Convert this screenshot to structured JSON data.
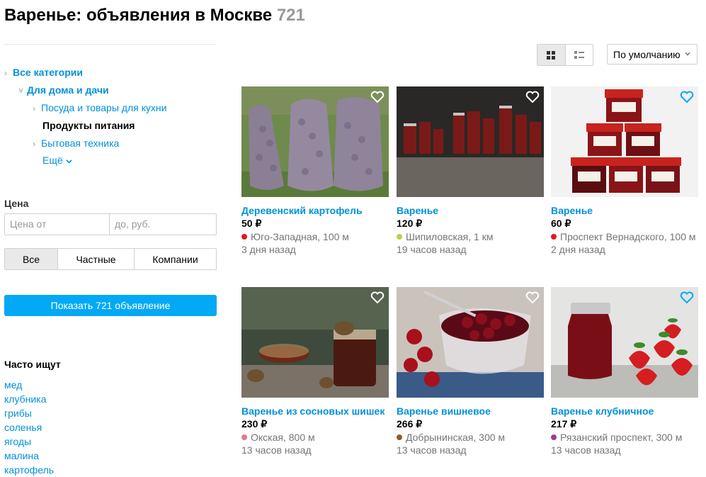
{
  "header": {
    "title": "Варенье: объявления в Москве",
    "count": "721"
  },
  "categories": {
    "all": "Все категории",
    "home": "Для дома и дачи",
    "dishes": "Посуда и товары для кухни",
    "food": "Продукты питания",
    "appliances": "Бытовая техника",
    "more": "Ещё"
  },
  "price": {
    "label": "Цена",
    "from_placeholder": "Цена от",
    "to_placeholder": "до, руб."
  },
  "seller_filter": {
    "all": "Все",
    "private": "Частные",
    "companies": "Компании"
  },
  "show_button": "Показать 721 объявление",
  "popular": {
    "title": "Часто ищут",
    "items": [
      "мед",
      "клубника",
      "грибы",
      "соленья",
      "ягоды",
      "малина",
      "картофель"
    ]
  },
  "sort": {
    "selected": "По умолчанию"
  },
  "listings": [
    {
      "title": "Деревенский картофель",
      "price": "50 ₽",
      "location": "Юго-Западная, 100 м",
      "date": "3 дня назад",
      "metro_color": "#e4191f"
    },
    {
      "title": "Варенье",
      "price": "120 ₽",
      "location": "Шипиловская, 1 км",
      "date": "19 часов назад",
      "metro_color": "#b4d445"
    },
    {
      "title": "Варенье",
      "price": "60 ₽",
      "location": "Проспект Вернадского, 100 м",
      "date": "2 дня назад",
      "metro_color": "#e4191f"
    },
    {
      "title": "Варенье из сосновых шишек",
      "price": "230 ₽",
      "location": "Окская, 800 м",
      "date": "13 часов назад",
      "metro_color": "#de7b8e"
    },
    {
      "title": "Варенье вишневое",
      "price": "266 ₽",
      "location": "Добрынинская, 300 м",
      "date": "13 часов назад",
      "metro_color": "#8d5b2d"
    },
    {
      "title": "Варенье клубничное",
      "price": "217 ₽",
      "location": "Рязанский проспект, 300 м",
      "date": "13 часов назад",
      "metro_color": "#943e90"
    }
  ],
  "colors": {
    "link": "#0091d9",
    "accent": "#03a9f4"
  }
}
